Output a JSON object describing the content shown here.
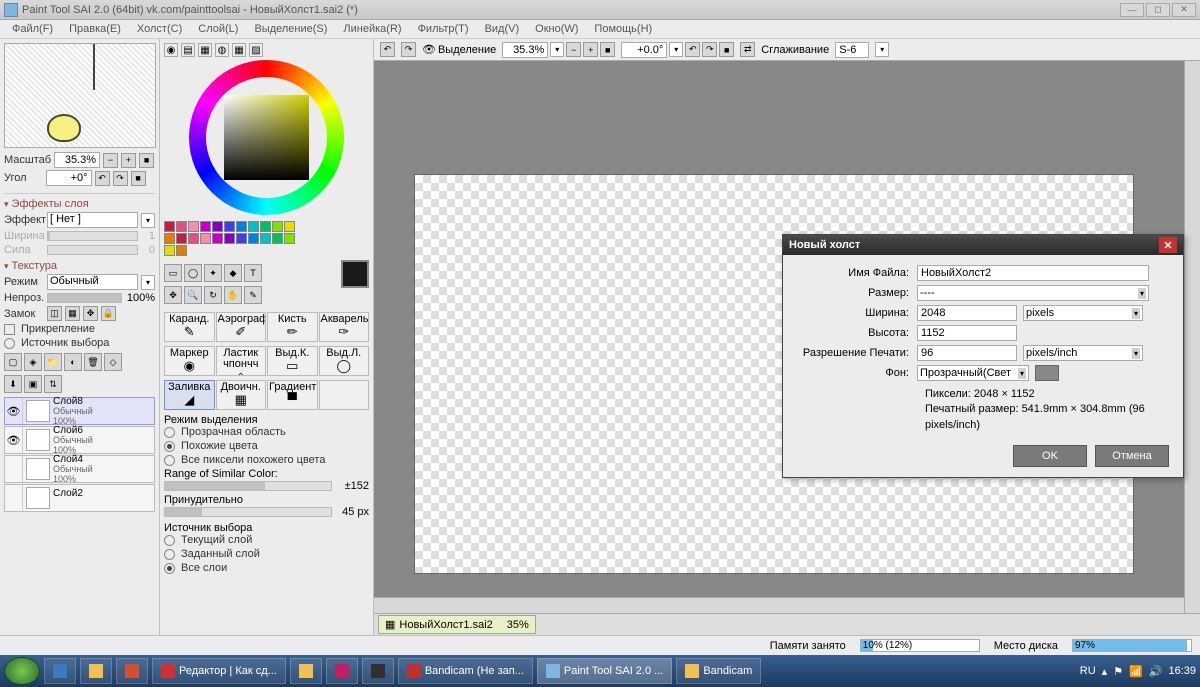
{
  "title": "Paint Tool SAI 2.0 (64bit) vk.com/painttoolsai - НовыйХолст1.sai2 (*)",
  "menu": [
    "Файл(F)",
    "Правка(E)",
    "Холст(C)",
    "Слой(L)",
    "Выделение(S)",
    "Линейка(R)",
    "Фильтр(T)",
    "Вид(V)",
    "Окно(W)",
    "Помощь(H)"
  ],
  "nav": {
    "scale_label": "Масштаб",
    "scale": "35.3%",
    "angle_label": "Угол",
    "angle": "+0°"
  },
  "effects": {
    "head": "Эффекты слоя",
    "effect_label": "Эффект",
    "effect": "[ Нет ]",
    "width_label": "Ширина",
    "width": "1",
    "power_label": "Сила",
    "power": "0"
  },
  "texture": {
    "head": "Текстура",
    "mode_label": "Режим",
    "mode": "Обычный",
    "opacity_label": "Непроз.",
    "opacity": "100%",
    "lock_label": "Замок",
    "pin_label": "Прикрепление",
    "clip_label": "Источник выбора"
  },
  "layers": [
    {
      "name": "Слой8",
      "mode": "Обычный",
      "op": "100%"
    },
    {
      "name": "Слой6",
      "mode": "Обычный",
      "op": "100%"
    },
    {
      "name": "Слой4",
      "mode": "Обычный",
      "op": "100%"
    },
    {
      "name": "Слой2",
      "mode": "",
      "op": ""
    }
  ],
  "swatches": [
    "#c02040",
    "#e05080",
    "#f090b0",
    "#c000c0",
    "#8000c0",
    "#4040e0",
    "#0080e0",
    "#00c0c0",
    "#00c060",
    "#80e000",
    "#e0e000",
    "#e08000",
    "#c02040",
    "#e05080",
    "#f090b0",
    "#c000c0",
    "#8000c0",
    "#4040e0",
    "#0080e0",
    "#00c0c0",
    "#00c060",
    "#80e000",
    "#e0e000",
    "#e08000"
  ],
  "tools": {
    "row1": [
      {
        "n": "Каранд.",
        "i": "✎"
      },
      {
        "n": "Аэрограф",
        "i": "✐"
      },
      {
        "n": "Кисть",
        "i": "✏"
      },
      {
        "n": "Акварель",
        "i": "✑"
      }
    ],
    "row2": [
      {
        "n": "Маркер",
        "i": "◉"
      },
      {
        "n": "Ластик чпончч",
        "i": "◇"
      },
      {
        "n": "Выд.К.",
        "i": "▭"
      },
      {
        "n": "Выд.Л.",
        "i": "◯"
      }
    ],
    "row3": [
      {
        "n": "Заливка",
        "i": "◢"
      },
      {
        "n": "Двоичн.",
        "i": "▦"
      },
      {
        "n": "Градиент",
        "i": "▀"
      },
      {
        "n": "",
        "i": ""
      }
    ]
  },
  "selmode": {
    "head": "Режим выделения",
    "o1": "Прозрачная область",
    "o2": "Похожие цвета",
    "o3": "Все пиксели похожего цвета",
    "range_label": "Range of Similar Color:",
    "range": "±152",
    "force_label": "Принудительно",
    "force": "45 px",
    "src_head": "Источник выбора",
    "s1": "Текущий слой",
    "s2": "Заданный слой",
    "s3": "Все слои"
  },
  "canvas_tb": {
    "vis": "Выделение",
    "zoom": "35.3%",
    "rot": "+0.0°",
    "stab_label": "Сглаживание",
    "stab": "S-6"
  },
  "doc_tab": {
    "name": "НовыйХолст1.sai2",
    "zoom": "35%"
  },
  "dialog": {
    "title": "Новый холст",
    "name_label": "Имя Файла:",
    "name": "НовыйХолст2",
    "size_label": "Размер:",
    "size": "----",
    "width_label": "Ширина:",
    "width": "2048",
    "height_label": "Высота:",
    "height": "1152",
    "unit": "pixels",
    "res_label": "Разрешение Печати:",
    "res": "96",
    "res_unit": "pixels/inch",
    "bg_label": "Фон:",
    "bg": "Прозрачный(Свет",
    "px_label": "Пиксели:",
    "px": "2048 × 1152",
    "print_label": "Печатный размер:",
    "print": "541.9mm × 304.8mm (96 pixels/inch)",
    "ok": "OK",
    "cancel": "Отмена"
  },
  "status": {
    "mem_label": "Памяти занято",
    "mem_text": "10% (12%)",
    "mem_pct": 10,
    "disk_label": "Место диска",
    "disk_text": "97%",
    "disk_pct": 97
  },
  "taskbar": {
    "items": [
      "Редактор | Как сд...",
      "",
      "",
      "",
      "",
      "Bandicam (Не зап...",
      "Paint Tool SAI 2.0 ...",
      "Bandicam"
    ],
    "lang": "RU",
    "time": "16:39"
  }
}
